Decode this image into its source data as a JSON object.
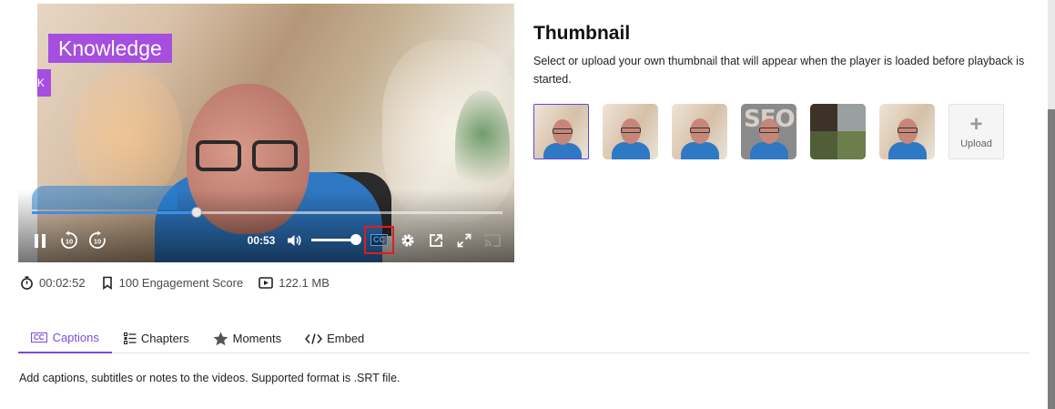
{
  "player": {
    "overlay_badge": "Knowledge",
    "side_badge": "K",
    "current_time": "00:53",
    "progress_fraction": 0.35,
    "volume_fraction": 0.95,
    "cc_label": "CC",
    "replay_back_label": "10",
    "replay_fwd_label": "10",
    "colors": {
      "badge": "#a54ee0",
      "progress": "#3d8fe6",
      "cc_highlight": "#e11d1d"
    }
  },
  "meta": {
    "duration": "00:02:52",
    "engagement": "100 Engagement Score",
    "size": "122.1 MB",
    "icons": [
      "timer-icon",
      "bookmark-icon",
      "video-file-icon"
    ]
  },
  "tabs": [
    {
      "label": "Captions",
      "icon": "cc-icon",
      "active": true
    },
    {
      "label": "Chapters",
      "icon": "chapters-list-icon",
      "active": false
    },
    {
      "label": "Moments",
      "icon": "star-icon",
      "active": false
    },
    {
      "label": "Embed",
      "icon": "code-icon",
      "active": false
    }
  ],
  "captions": {
    "description": "Add captions, subtitles or notes to the videos. Supported format is .SRT file."
  },
  "thumbnail": {
    "title": "Thumbnail",
    "description": "Select or upload your own thumbnail that will appear when the player is loaded before playback is started.",
    "seo_text": "SEO",
    "upload_label": "Upload",
    "accent": "#5b4ad8"
  }
}
